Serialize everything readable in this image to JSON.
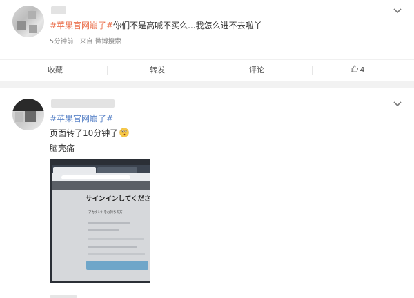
{
  "post1": {
    "hashtag": "#苹果官网崩了#",
    "text": "你们不是高喊不买么...我怎么进不去啦丫",
    "time": "5分钟前",
    "source": "来自 微博搜索",
    "actions": {
      "favorite": "收藏",
      "repost": "转发",
      "comment": "评论",
      "like_count": "4"
    }
  },
  "post2": {
    "hashtag": "#苹果官网崩了#",
    "line1": "页面转了10分钟了",
    "line2": "脑壳痛",
    "image": {
      "heading": "サインインしてください。",
      "sub": "アカウントをお持ちの方"
    }
  },
  "colors": {
    "hashtag": "#eb7350",
    "hashtag_alt": "#5d86c9",
    "meta": "#888888",
    "divider": "#f2f2f2"
  }
}
